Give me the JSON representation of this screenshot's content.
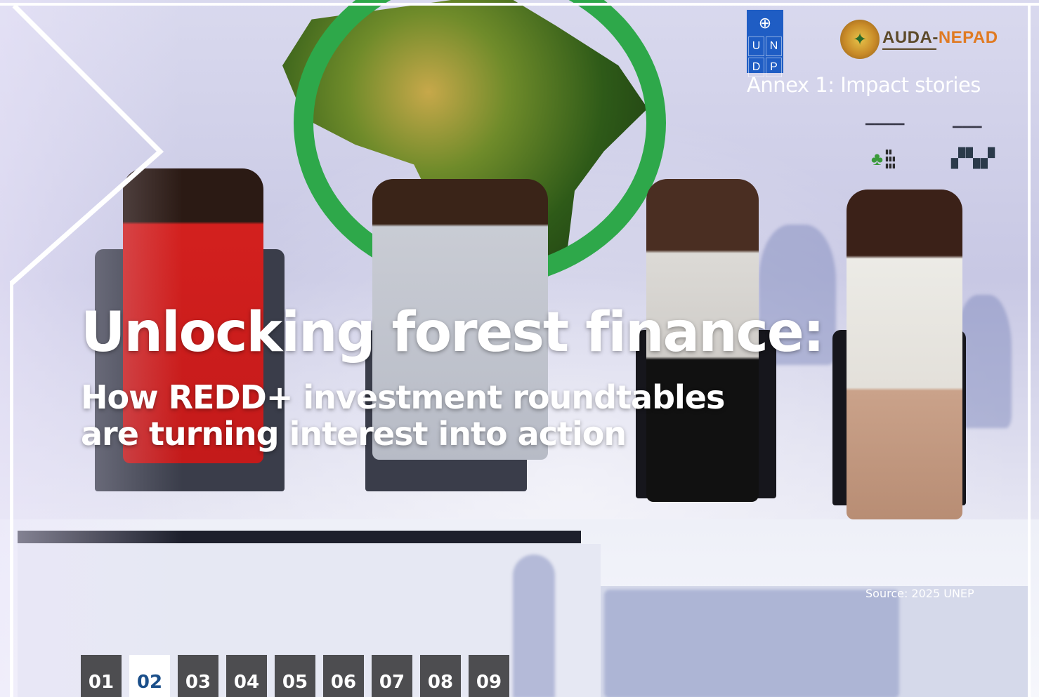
{
  "header": {
    "annex_label": "Annex 1: Impact stories",
    "logos": {
      "undp_letters": [
        "U",
        "N",
        "D",
        "P"
      ],
      "auda_wordmark_main": "AUDA-",
      "auda_wordmark_accent": "NEPAD"
    }
  },
  "hero": {
    "title": "Unlocking forest finance:",
    "subtitle_line1": "How REDD+ investment roundtables",
    "subtitle_line2": "are turning interest into action",
    "source": "Source: 2025 UNEP"
  },
  "pagination": {
    "pages": [
      "01",
      "02",
      "03",
      "04",
      "05",
      "06",
      "07",
      "08",
      "09"
    ],
    "active_page": "02"
  },
  "colors": {
    "accent_blue": "#1b4f8a",
    "pager_bg": "#4d4d50",
    "ring_green": "#2ea84a",
    "undp_blue": "#1f5dc4"
  },
  "icons": [
    "undp-logo-icon",
    "auda-nepad-logo-icon",
    "go-green-africa-logo-icon",
    "vuka-logo-icon"
  ]
}
